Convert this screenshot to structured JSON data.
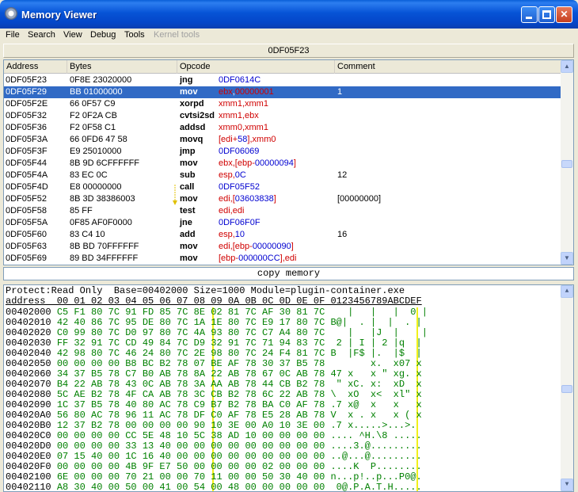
{
  "window": {
    "title": "Memory Viewer"
  },
  "menu": [
    {
      "label": "File",
      "disabled": false
    },
    {
      "label": "Search",
      "disabled": false
    },
    {
      "label": "View",
      "disabled": false
    },
    {
      "label": "Debug",
      "disabled": false
    },
    {
      "label": "Tools",
      "disabled": false
    },
    {
      "label": "Kernel tools",
      "disabled": true
    }
  ],
  "address_bar": "0DF05F23",
  "disasm": {
    "columns": [
      "Address",
      "Bytes",
      "Opcode",
      "Comment"
    ],
    "rows": [
      {
        "addr": "0DF05F23",
        "bytes": "0F8E 23020000",
        "op": "jng",
        "args": [
          [
            "num",
            "0DF0614C"
          ]
        ],
        "comment": ""
      },
      {
        "addr": "0DF05F29",
        "bytes": "BB 01000000",
        "op": "mov",
        "args": [
          [
            "reg",
            "ebx"
          ],
          [
            "plain",
            ","
          ],
          [
            "num",
            "00000001"
          ]
        ],
        "comment": "1",
        "selected": true
      },
      {
        "addr": "0DF05F2E",
        "bytes": "66 0F57 C9",
        "op": "xorpd",
        "args": [
          [
            "reg",
            "xmm1,xmm1"
          ]
        ],
        "comment": ""
      },
      {
        "addr": "0DF05F32",
        "bytes": "F2 0F2A CB",
        "op": "cvtsi2sd",
        "args": [
          [
            "reg",
            "xmm1,ebx"
          ]
        ],
        "comment": ""
      },
      {
        "addr": "0DF05F36",
        "bytes": "F2 0F58 C1",
        "op": "addsd",
        "args": [
          [
            "reg",
            "xmm0,xmm1"
          ]
        ],
        "comment": ""
      },
      {
        "addr": "0DF05F3A",
        "bytes": "66 0FD6 47 58",
        "op": "movq",
        "args": [
          [
            "reg",
            "[edi+"
          ],
          [
            "num",
            "58"
          ],
          [
            "reg",
            "],xmm0"
          ]
        ],
        "comment": ""
      },
      {
        "addr": "0DF05F3F",
        "bytes": "E9 25010000",
        "op": "jmp",
        "args": [
          [
            "num",
            "0DF06069"
          ]
        ],
        "comment": ""
      },
      {
        "addr": "0DF05F44",
        "bytes": "8B 9D 6CFFFFFF",
        "op": "mov",
        "args": [
          [
            "reg",
            "ebx,[ebp-"
          ],
          [
            "num",
            "00000094"
          ],
          [
            "reg",
            "]"
          ]
        ],
        "comment": ""
      },
      {
        "addr": "0DF05F4A",
        "bytes": "83 EC 0C",
        "op": "sub",
        "args": [
          [
            "reg",
            "esp,"
          ],
          [
            "num",
            "0C"
          ]
        ],
        "comment": "12"
      },
      {
        "addr": "0DF05F4D",
        "bytes": "E8 00000000",
        "op": "call",
        "args": [
          [
            "num",
            "0DF05F52"
          ]
        ],
        "comment": ""
      },
      {
        "addr": "0DF05F52",
        "bytes": "8B 3D 38386003",
        "op": "mov",
        "args": [
          [
            "reg",
            "edi,["
          ],
          [
            "num",
            "03603838"
          ],
          [
            "reg",
            "]"
          ]
        ],
        "comment": "[00000000]"
      },
      {
        "addr": "0DF05F58",
        "bytes": "85 FF",
        "op": "test",
        "args": [
          [
            "reg",
            "edi,edi"
          ]
        ],
        "comment": ""
      },
      {
        "addr": "0DF05F5A",
        "bytes": "0F85 AF0F0000",
        "op": "jne",
        "args": [
          [
            "num",
            "0DF06F0F"
          ]
        ],
        "comment": ""
      },
      {
        "addr": "0DF05F60",
        "bytes": "83 C4 10",
        "op": "add",
        "args": [
          [
            "reg",
            "esp,"
          ],
          [
            "num",
            "10"
          ]
        ],
        "comment": "16"
      },
      {
        "addr": "0DF05F63",
        "bytes": "8B BD 70FFFFFF",
        "op": "mov",
        "args": [
          [
            "reg",
            "edi,[ebp-"
          ],
          [
            "num",
            "00000090"
          ],
          [
            "reg",
            "]"
          ]
        ],
        "comment": ""
      },
      {
        "addr": "0DF05F69",
        "bytes": "89 BD 34FFFFFF",
        "op": "mov",
        "args": [
          [
            "reg",
            "[ebp-"
          ],
          [
            "num",
            "000000CC"
          ],
          [
            "reg",
            "],edi"
          ]
        ],
        "comment": ""
      }
    ]
  },
  "copy_memory_label": "copy memory",
  "hex": {
    "info": "Protect:Read Only  Base=00402000 Size=1000 Module=plugin-container.exe",
    "header": "address  00 01 02 03 04 05 06 07 08 09 0A 0B 0C 0D 0E 0F 0123456789ABCDEF",
    "rows": [
      {
        "addr": "00402000",
        "bytes": "C5 F1 80 7C 91 FD 85 7C 8E 02 81 7C AF 30 81 7C",
        "ascii": "   |   |   |  0 |"
      },
      {
        "addr": "00402010",
        "bytes": "42 40 86 7C 95 DE 80 7C 1A 1E 80 7C E9 17 80 7C",
        "ascii": "B@|  . |  |  . |"
      },
      {
        "addr": "00402020",
        "bytes": "C0 99 80 7C D0 97 80 7C 4A 93 80 7C C7 A4 80 7C",
        "ascii": "   |   |J  |    |"
      },
      {
        "addr": "00402030",
        "bytes": "FF 32 91 7C CD 49 84 7C D9 32 91 7C 71 94 83 7C",
        "ascii": " 2 | I | 2 |q  |"
      },
      {
        "addr": "00402040",
        "bytes": "42 98 80 7C 46 24 80 7C 2E 98 80 7C 24 F4 81 7C",
        "ascii": "B  |F$ |.  |$  |"
      },
      {
        "addr": "00402050",
        "bytes": "00 00 00 00 B8 BC B2 78 07 BE AF 78 30 37 B5 78",
        "ascii": "       x.  x07 x"
      },
      {
        "addr": "00402060",
        "bytes": "34 37 B5 78 C7 B0 AB 78 8A 22 AB 78 67 0C AB 78",
        "ascii": "47 x   x \" xg. x"
      },
      {
        "addr": "00402070",
        "bytes": "B4 22 AB 78 43 0C AB 78 3A AA AB 78 44 CB B2 78",
        "ascii": " \" xC. x:  xD  x"
      },
      {
        "addr": "00402080",
        "bytes": "5C AE B2 78 4F CA AB 78 3C CB B2 78 6C 22 AB 78",
        "ascii": "\\  xO  x<  xl\" x"
      },
      {
        "addr": "00402090",
        "bytes": "1C 37 B5 78 40 80 AC 78 C9 B7 B2 78 BA C0 AF 78",
        "ascii": ".7 x@  x   x   x"
      },
      {
        "addr": "004020A0",
        "bytes": "56 80 AC 78 96 11 AC 78 DF C0 AF 78 E5 28 AB 78",
        "ascii": "V  x . x   x ( x"
      },
      {
        "addr": "004020B0",
        "bytes": "12 37 B2 78 00 00 00 00 90 10 3E 00 A0 10 3E 00",
        "ascii": ".7 x.....>...>."
      },
      {
        "addr": "004020C0",
        "bytes": "00 00 00 00 CC 5E 48 10 5C 38 AD 10 00 00 00 00",
        "ascii": ".... ^H.\\8 ....."
      },
      {
        "addr": "004020D0",
        "bytes": "00 00 00 00 33 13 40 00 00 00 00 00 00 00 00 00",
        "ascii": "....3.@........."
      },
      {
        "addr": "004020E0",
        "bytes": "07 15 40 00 1C 16 40 00 00 00 00 00 00 00 00 00",
        "ascii": "..@...@........."
      },
      {
        "addr": "004020F0",
        "bytes": "00 00 00 00 4B 9F E7 50 00 00 00 00 02 00 00 00",
        "ascii": "....K  P........"
      },
      {
        "addr": "00402100",
        "bytes": "6E 00 00 00 70 21 00 00 70 11 00 00 50 30 40 00",
        "ascii": "n...p!..p...P0@."
      },
      {
        "addr": "00402110",
        "bytes": "A8 30 40 00 50 00 41 00 54 00 48 00 00 00 00 00",
        "ascii": " 0@.P.A.T.H....."
      }
    ]
  },
  "colors": {
    "titlebar": "#0653d6",
    "selection": "#316ac5",
    "register": "#d00000",
    "number": "#0000d0",
    "hex_bytes": "#008000"
  }
}
